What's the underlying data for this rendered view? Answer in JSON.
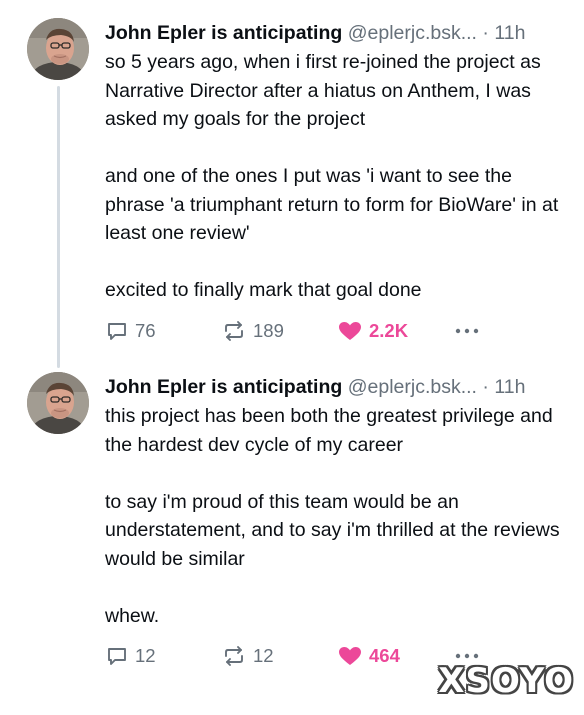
{
  "posts": [
    {
      "author": "John Epler is anticipating",
      "handle": "@eplerjc.bsk...",
      "dot": "·",
      "time": "11h",
      "paragraphs": [
        "so 5 years ago, when i first re-joined the project as Narrative Director after a hiatus on Anthem, I was asked my goals for the project",
        "and one of the ones I put was 'i want to see the phrase 'a triumphant return to form for BioWare' in at least one review'",
        "excited to finally mark that goal done"
      ],
      "replies": "76",
      "reposts": "189",
      "likes": "2.2K"
    },
    {
      "author": "John Epler is anticipating",
      "handle": "@eplerjc.bsk...",
      "dot": "·",
      "time": "11h",
      "paragraphs": [
        "this project has been both the greatest privilege and the hardest dev cycle of my career",
        "to say i'm proud of this team would be an understatement, and to say i'm thrilled at the reviews would be similar",
        "whew."
      ],
      "replies": "12",
      "reposts": "12",
      "likes": "464"
    }
  ],
  "icons": {
    "reply": "reply-icon",
    "repost": "repost-icon",
    "like": "heart-icon",
    "more": "more-icon"
  },
  "colors": {
    "like": "#ec4899",
    "muted": "#66707a",
    "thread_line": "#d4dbe2"
  },
  "watermark": "XSOYO"
}
